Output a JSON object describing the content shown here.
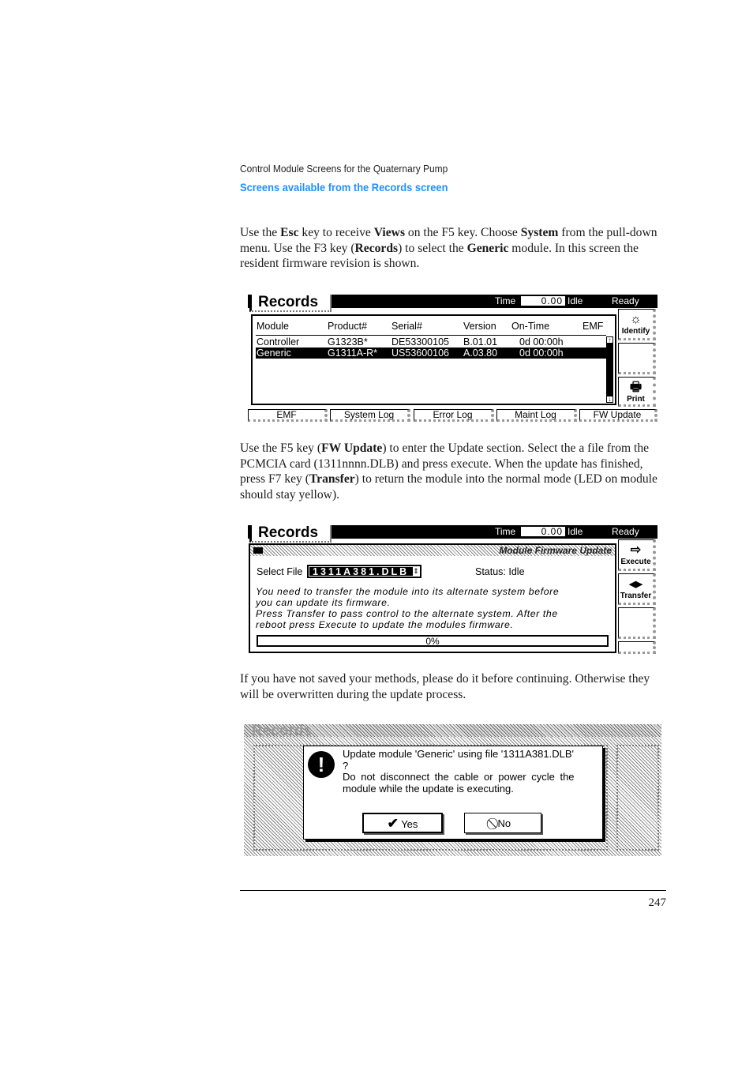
{
  "header": {
    "running_head": "Control Module Screens for the Quaternary Pump",
    "section_title": "Screens available from the Records screen",
    "accent_color": "#1e90ff"
  },
  "paragraphs": {
    "p1": [
      {
        "t": "Use the ",
        "b": false
      },
      {
        "t": "Esc",
        "b": true
      },
      {
        "t": " key to receive ",
        "b": false
      },
      {
        "t": "Views",
        "b": true
      },
      {
        "t": " on the F5 key. Choose ",
        "b": false
      },
      {
        "t": "System",
        "b": true
      },
      {
        "t": " from the pull-down menu. Use the F3 key (",
        "b": false
      },
      {
        "t": "Records",
        "b": true
      },
      {
        "t": ") to select the ",
        "b": false
      },
      {
        "t": "Generic",
        "b": true
      },
      {
        "t": " module. In this screen the resident firmware revision is shown.",
        "b": false
      }
    ],
    "p2": [
      {
        "t": "Use the F5 key (",
        "b": false
      },
      {
        "t": "FW Update",
        "b": true
      },
      {
        "t": ") to enter the Update section. Select the a file from the PCMCIA card (1311nnnn.DLB) and press execute. When the update has finished, press F7 key (",
        "b": false
      },
      {
        "t": "Transfer",
        "b": true
      },
      {
        "t": ") to return the module into the normal mode (LED on module should stay yellow).",
        "b": false
      }
    ],
    "p3": [
      {
        "t": "If you have not saved your methods, please do it before continuing. Otherwise they will be overwritten during the update process.",
        "b": false
      }
    ]
  },
  "screen1": {
    "title": "Records",
    "time_label": "Time",
    "time_value": "0.00",
    "state": "Idle",
    "status": "Ready",
    "columns": [
      "Module",
      "Product#",
      "Serial#",
      "Version",
      "On-Time",
      "EMF"
    ],
    "rows": [
      {
        "module": "Controller",
        "product": "G1323B*",
        "serial": "DE53300105",
        "version": "B.01.01",
        "on_time": "0d 00:00h",
        "emf": "",
        "selected": false
      },
      {
        "module": "Generic",
        "product": "G1311A-R*",
        "serial": "US53600106",
        "version": "A.03.80",
        "on_time": "0d 00:00h",
        "emf": "",
        "selected": true
      }
    ],
    "side_buttons": [
      {
        "label": "Identify",
        "icon": "sun-icon",
        "glyph": "☼"
      },
      {
        "label": "",
        "icon": "",
        "glyph": ""
      },
      {
        "label": "Print",
        "icon": "printer-icon",
        "glyph": "🖶"
      }
    ],
    "function_keys": [
      "EMF",
      "System Log",
      "Error Log",
      "Maint Log",
      "FW Update"
    ]
  },
  "screen2": {
    "title": "Records",
    "time_label": "Time",
    "time_value": "0.00",
    "state": "Idle",
    "status": "Ready",
    "panel_title": "Module Firmware Update",
    "select_file_label": "Select File",
    "select_file_value": "1311A381.DLB",
    "status_text": "Status: Idle",
    "message_lines": [
      "You need to transfer the module into its alternate system before",
      "you can update its firmware.",
      "Press Transfer to pass control to the alternate system. After the",
      "reboot press Execute to update the modules firmware."
    ],
    "progress_percent": 0,
    "progress_label": "0%",
    "side_buttons": [
      {
        "label": "Execute",
        "icon": "arrow-right-icon",
        "glyph": "⇨"
      },
      {
        "label": "Transfer",
        "icon": "transfer-arrows-icon",
        "glyph": "◀▶"
      },
      {
        "label": "",
        "icon": "",
        "glyph": ""
      }
    ]
  },
  "screen3": {
    "background_title": "Records",
    "dialog": {
      "icon": "exclamation-icon",
      "line1": "Update module 'Generic' using file '1311A381.DLB'",
      "line2": "?",
      "line3": "Do not disconnect the cable or power cycle the",
      "line4": "module while the update is executing.",
      "yes_label": "Yes",
      "no_label": "No"
    }
  },
  "footer": {
    "page_number": "247"
  }
}
